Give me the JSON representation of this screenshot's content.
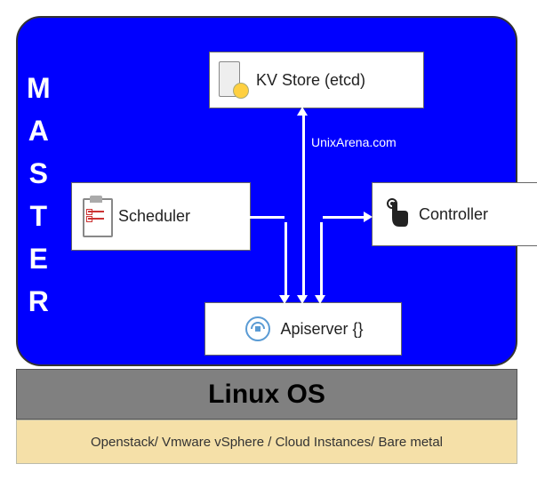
{
  "master_label": "MASTER",
  "components": {
    "kv_store": "KV Store (etcd)",
    "scheduler": "Scheduler",
    "controller": "Controller",
    "apiserver": "Apiserver {}"
  },
  "attribution": "UnixArena.com",
  "layers": {
    "linux": "Linux OS",
    "infra": "Openstack/ Vmware vSphere / Cloud Instances/ Bare metal"
  }
}
